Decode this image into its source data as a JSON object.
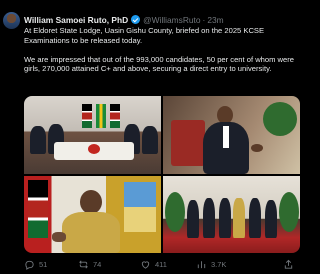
{
  "author": {
    "name": "William Samoei Ruto, PhD",
    "handle": "@WilliamsRuto",
    "separator": "·",
    "time": "23m"
  },
  "tweet": {
    "paragraph1": "At Eldoret State Lodge, Uasin Gishu County, briefed on the 2025 KCSE Examinations to be released today.",
    "paragraph2": "We are impressed that out of the 993,000 candidates, 50 per cent of whom were girls, 270,000 attained C+ and above, securing a direct entry to university."
  },
  "actions": {
    "replies": "51",
    "reposts": "74",
    "likes": "411",
    "views": "3.7K"
  },
  "icons": {
    "verified": "verified-badge-icon",
    "reply": "reply-icon",
    "repost": "repost-icon",
    "like": "heart-icon",
    "views": "bar-chart-icon",
    "share": "share-icon"
  },
  "colors": {
    "background": "#000000",
    "text": "#e7e9ea",
    "muted": "#71767b",
    "verified": "#1d9bf0"
  }
}
